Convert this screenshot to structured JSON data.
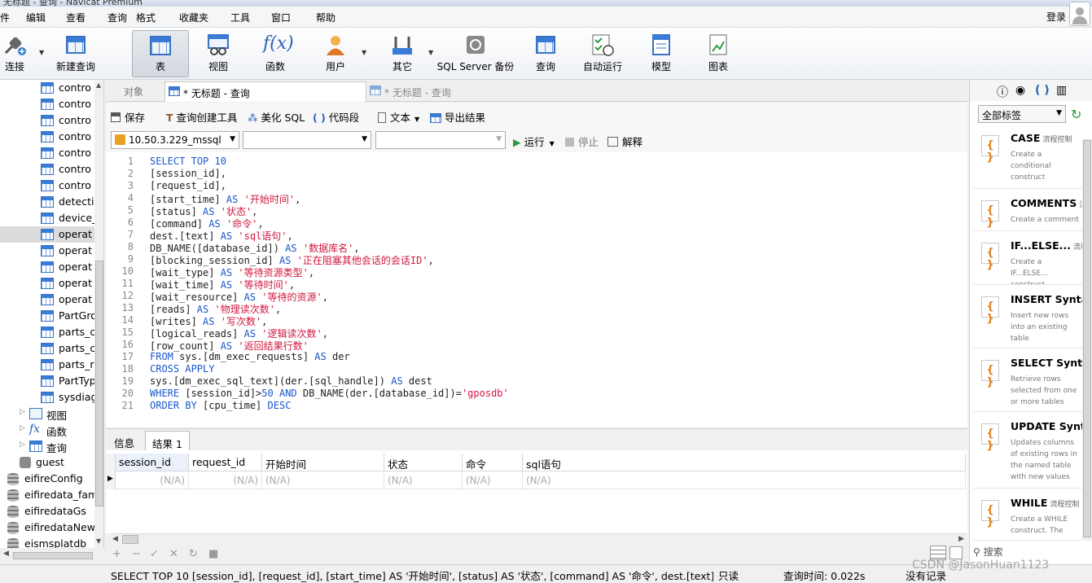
{
  "window": {
    "title": "无标题 - 查询 - Navicat Premium"
  },
  "menu": [
    "件",
    "编辑",
    "查看",
    "查询",
    "格式",
    "收藏夹",
    "工具",
    "窗口",
    "帮助"
  ],
  "login_label": "登录",
  "toolbar": {
    "connect": "连接",
    "new_query": "新建查询",
    "table": "表",
    "view": "视图",
    "function": "函数",
    "user": "用户",
    "other": "其它",
    "backup": "SQL Server 备份",
    "query": "查询",
    "auto_run": "自动运行",
    "model": "模型",
    "chart": "图表"
  },
  "sidebar": {
    "tables": [
      "contro",
      "contro",
      "contro",
      "contro",
      "contro",
      "contro",
      "contro",
      "detecti",
      "device_",
      "operat",
      "operat",
      "operat",
      "operat",
      "operat",
      "PartGro",
      "parts_c",
      "parts_c",
      "parts_r",
      "PartTyp",
      "sysdiag"
    ],
    "groups": [
      "视图",
      "函数",
      "查询"
    ],
    "guest": "guest",
    "databases": [
      "eifireConfig",
      "eifiredata_fam",
      "eifiredataGs",
      "eifiredataNew",
      "eismsplatdb"
    ]
  },
  "doc_tabs": {
    "objects": "对象",
    "active": "* 无标题 - 查询",
    "inactive": "* 无标题 - 查询"
  },
  "editor_toolbar": {
    "save": "保存",
    "query_builder": "查询创建工具",
    "beautify": "美化 SQL",
    "snippet": "代码段",
    "text": "文本",
    "export": "导出结果"
  },
  "conn_bar": {
    "connection": "10.50.3.229_mssql",
    "run": "运行",
    "stop": "停止",
    "explain": "解释"
  },
  "sql_lines": [
    "SELECT TOP 10",
    "[session_id],",
    "[request_id],",
    "[start_time] AS '开始时间',",
    "[status] AS '状态',",
    "[command] AS '命令',",
    "dest.[text] AS 'sql语句',",
    "DB_NAME([database_id]) AS '数据库名',",
    "[blocking_session_id] AS '正在阻塞其他会话的会话ID',",
    "[wait_type] AS '等待资源类型',",
    "[wait_time] AS '等待时间',",
    "[wait_resource] AS '等待的资源',",
    "[reads] AS '物理读次数',",
    "[writes] AS '写次数',",
    "[logical_reads] AS '逻辑读次数',",
    "[row_count] AS '返回结果行数'",
    "FROM sys.[dm_exec_requests] AS der",
    "CROSS APPLY",
    "sys.[dm_exec_sql_text](der.[sql_handle]) AS dest",
    "WHERE [session_id]>50 AND DB_NAME(der.[database_id])='gposdb'",
    "ORDER BY [cpu_time] DESC"
  ],
  "result_tabs": {
    "info": "信息",
    "result": "结果 1"
  },
  "grid": {
    "columns": [
      "session_id",
      "request_id",
      "开始时间",
      "状态",
      "命令",
      "sql语句"
    ],
    "row": [
      "(N/A)",
      "(N/A)",
      "(N/A)",
      "(N/A)",
      "(N/A)",
      "(N/A)"
    ]
  },
  "status": {
    "sql": "SELECT TOP 10 [session_id], [request_id], [start_time] AS '开始时间', [status] AS '状态', [command] AS '命令', dest.[text] AS 'sql语句",
    "readonly": "只读",
    "query_time": "查询时间: 0.022s",
    "no_records": "没有记录"
  },
  "right_panel": {
    "tag_filter": "全部标签",
    "snippets": [
      {
        "title": "CASE",
        "tag": "流程控制",
        "desc": "Create a conditional construct"
      },
      {
        "title": "COMMENTS",
        "tag": "注",
        "desc": "Create a comment"
      },
      {
        "title": "IF...ELSE...",
        "tag": "流程控",
        "desc": "Create a IF...ELSE... construct"
      },
      {
        "title": "INSERT Syntax",
        "tag": "",
        "desc": "Insert new rows into an existing table"
      },
      {
        "title": "SELECT Syntax",
        "tag": "",
        "desc": "Retrieve rows selected from one or more tables"
      },
      {
        "title": "UPDATE Synta",
        "tag": "",
        "desc": "Updates columns of existing rows in the named table with new values"
      },
      {
        "title": "WHILE",
        "tag": "流程控制",
        "desc": "Create a WHILE construct. The"
      }
    ],
    "search_placeholder": "搜索"
  },
  "watermark": "CSDN @JasonHuan1123"
}
